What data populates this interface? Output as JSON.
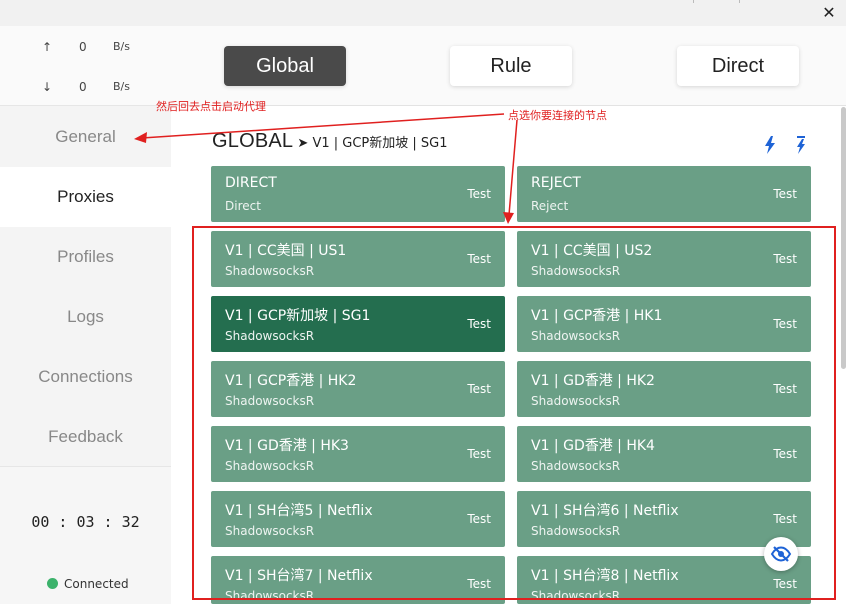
{
  "window": {
    "close_glyph": "✕"
  },
  "traffic": {
    "up_arrow": "↑",
    "up_value": "0",
    "up_unit": "B/s",
    "down_arrow": "↓",
    "down_value": "0",
    "down_unit": "B/s"
  },
  "sidebar": {
    "items": [
      {
        "label": "General"
      },
      {
        "label": "Proxies"
      },
      {
        "label": "Profiles"
      },
      {
        "label": "Logs"
      },
      {
        "label": "Connections"
      },
      {
        "label": "Feedback"
      }
    ],
    "uptime": "00 : 03 : 32",
    "status": "Connected",
    "status_color": "#3bb26b"
  },
  "modes": [
    {
      "label": "Global"
    },
    {
      "label": "Rule"
    },
    {
      "label": "Direct"
    }
  ],
  "group": {
    "name": "GLOBAL",
    "arrow": "➤",
    "selected": "V1 | GCP新加坡 | SG1",
    "icons": [
      "latency-test-icon",
      "speed-test-icon"
    ]
  },
  "proxies": [
    {
      "name": "DIRECT",
      "type": "Direct",
      "test": "Test"
    },
    {
      "name": "REJECT",
      "type": "Reject",
      "test": "Test"
    },
    {
      "name": "V1 | CC美国 | US1",
      "type": "ShadowsocksR",
      "test": "Test"
    },
    {
      "name": "V1 | CC美国 | US2",
      "type": "ShadowsocksR",
      "test": "Test"
    },
    {
      "name": "V1 | GCP新加坡 | SG1",
      "type": "ShadowsocksR",
      "test": "Test"
    },
    {
      "name": "V1 | GCP香港 | HK1",
      "type": "ShadowsocksR",
      "test": "Test"
    },
    {
      "name": "V1 | GCP香港 | HK2",
      "type": "ShadowsocksR",
      "test": "Test"
    },
    {
      "name": "V1 | GD香港 | HK2",
      "type": "ShadowsocksR",
      "test": "Test"
    },
    {
      "name": "V1 | GD香港 | HK3",
      "type": "ShadowsocksR",
      "test": "Test"
    },
    {
      "name": "V1 | GD香港 | HK4",
      "type": "ShadowsocksR",
      "test": "Test"
    },
    {
      "name": "V1 | SH台湾5 | Netflix",
      "type": "ShadowsocksR",
      "test": "Test"
    },
    {
      "name": "V1 | SH台湾6 | Netflix",
      "type": "ShadowsocksR",
      "test": "Test"
    },
    {
      "name": "V1 | SH台湾7 | Netflix",
      "type": "ShadowsocksR",
      "test": "Test"
    },
    {
      "name": "V1 | SH台湾8 | Netflix",
      "type": "ShadowsocksR",
      "test": "Test"
    }
  ],
  "colors": {
    "card": "#6a9f86",
    "card_selected": "#246e4f",
    "accent": "#1e63d6",
    "annotation": "#e0201f"
  },
  "annotations": {
    "general_note": "然后回去点击启动代理",
    "proxy_note": "点选你要连接的节点"
  }
}
